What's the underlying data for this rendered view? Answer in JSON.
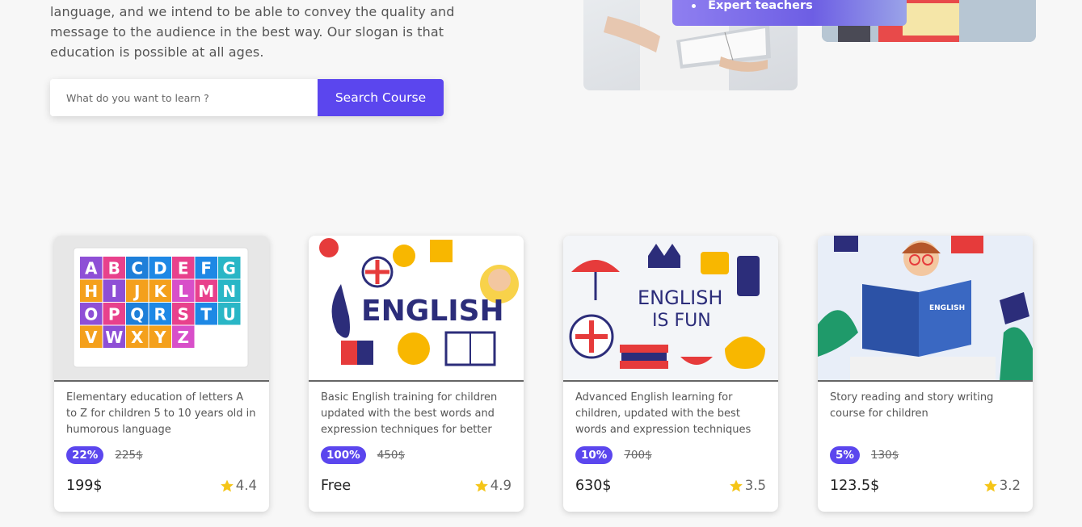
{
  "intro": {
    "line1": "language, and we intend to be able to convey the quality and",
    "line2": "message to the audience in the best way. Our slogan is that",
    "line3": "education is possible at all ages."
  },
  "search": {
    "placeholder": "What do you want to learn ?",
    "button_label": "Search Course"
  },
  "hero": {
    "feature": "Expert teachers"
  },
  "courses": [
    {
      "description": "Elementary education of letters A to Z for children 5 to 10 years old in humorous language",
      "discount": "22%",
      "old_price": "225$",
      "price": "199$",
      "rating": "4.4"
    },
    {
      "description": "Basic English training for children updated with the best words and expression techniques for better",
      "discount": "100%",
      "old_price": "450$",
      "price": "Free",
      "rating": "4.9",
      "thumb_text": "ENGLISH"
    },
    {
      "description": "Advanced English learning for children, updated with the best words and expression techniques",
      "discount": "10%",
      "old_price": "700$",
      "price": "630$",
      "rating": "3.5",
      "thumb_text_1": "ENGLISH",
      "thumb_text_2": "IS FUN"
    },
    {
      "description": "Story reading and story writing course for children",
      "discount": "5%",
      "old_price": "130$",
      "price": "123.5$",
      "rating": "3.2",
      "thumb_text": "ENGLISH"
    }
  ],
  "alphabet": [
    "A",
    "B",
    "C",
    "D",
    "E",
    "F",
    "G",
    "H",
    "I",
    "J",
    "K",
    "L",
    "M",
    "N",
    "O",
    "P",
    "Q",
    "R",
    "S",
    "T",
    "U",
    "V",
    "W",
    "X",
    "Y",
    "Z"
  ],
  "colors": {
    "accent": "#5b46ee",
    "star": "#f5c518"
  }
}
